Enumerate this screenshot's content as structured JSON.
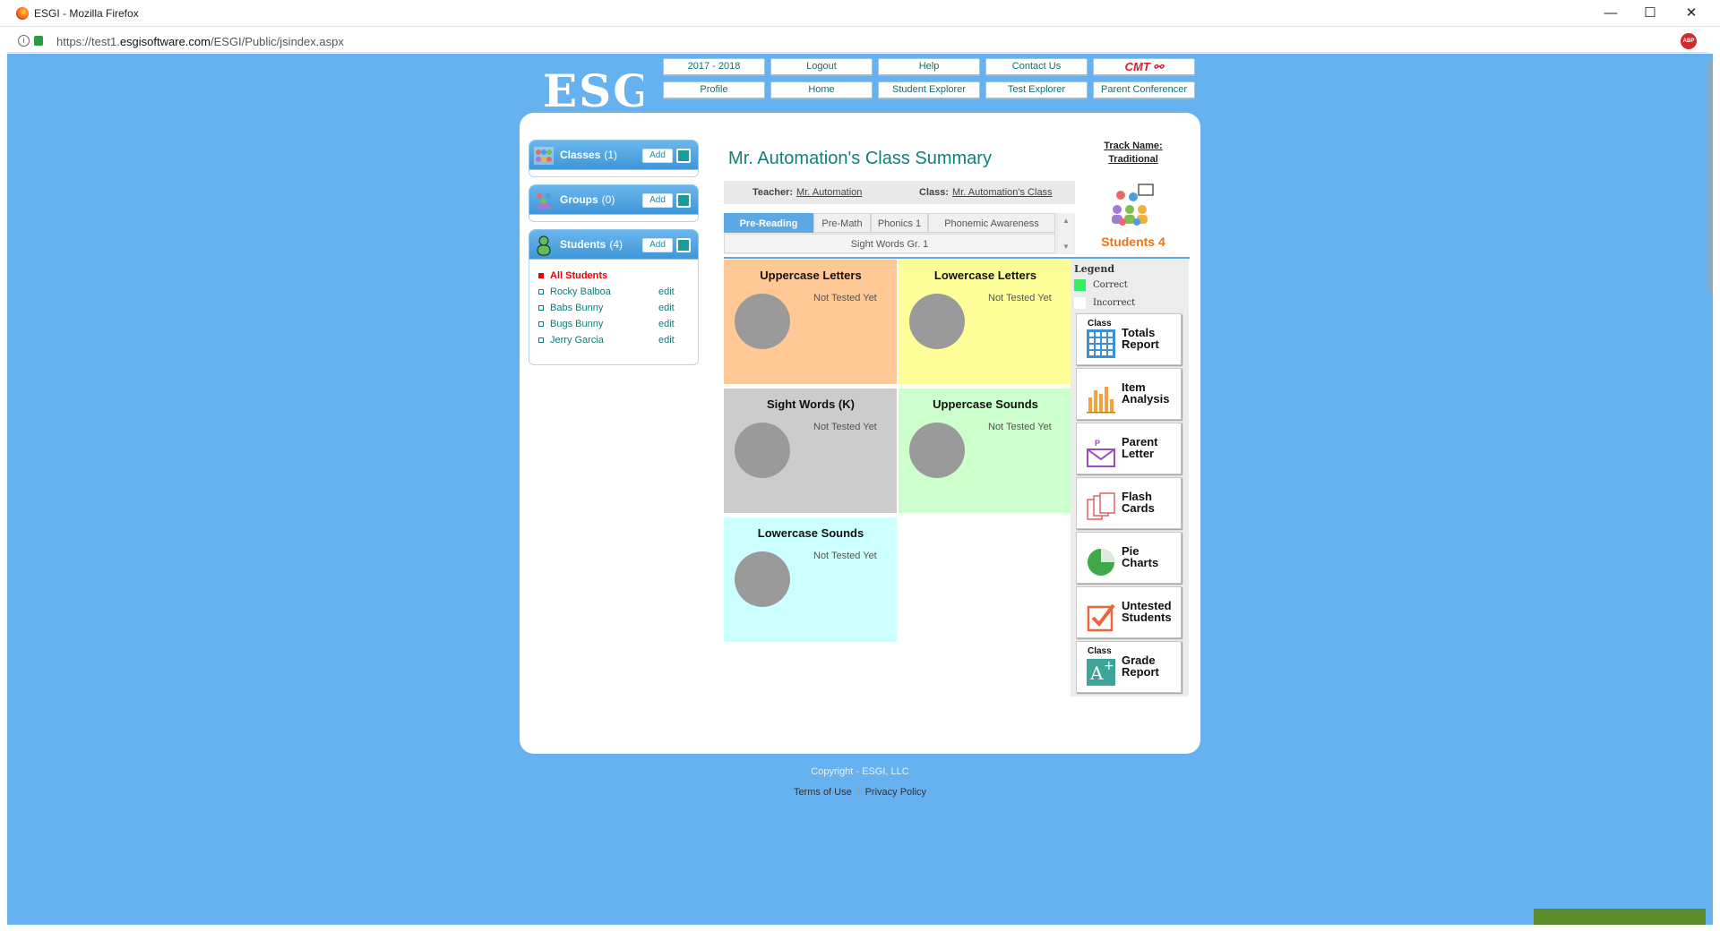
{
  "browser": {
    "title": "ESGI - Mozilla Firefox",
    "url_host": "https://test1.",
    "url_domain": "esgisoftware.com",
    "url_path": "/ESGI/Public/jsindex.aspx",
    "abp": "ABP",
    "controls": {
      "minimize": "—",
      "maximize": "☐",
      "close": "✕"
    }
  },
  "logo": "ESGI",
  "nav": {
    "row1": [
      "2017 - 2018",
      "Logout",
      "Help",
      "Contact Us"
    ],
    "cmt": "CMT ⚯",
    "row2": [
      "Profile",
      "Home",
      "Student Explorer",
      "Test Explorer",
      "Parent Conferencer"
    ]
  },
  "sidebar": {
    "classes": {
      "label": "Classes",
      "count": "(1)",
      "add": "Add"
    },
    "groups": {
      "label": "Groups",
      "count": "(0)",
      "add": "Add"
    },
    "students": {
      "label": "Students",
      "count": "(4)",
      "add": "Add"
    },
    "all_students": "All Students",
    "student_list": [
      {
        "name": "Rocky Balboa",
        "edit": "edit"
      },
      {
        "name": "Babs Bunny",
        "edit": "edit"
      },
      {
        "name": "Bugs Bunny",
        "edit": "edit"
      },
      {
        "name": "Jerry Garcia",
        "edit": "edit"
      }
    ]
  },
  "summary": {
    "title": "Mr. Automation's Class Summary",
    "teacher_label": "Teacher:",
    "teacher": "Mr. Automation",
    "class_label": "Class:",
    "class": "Mr. Automation's Class",
    "track_label": "Track Name:",
    "track": "Traditional",
    "students_total": "Students 4"
  },
  "tabs": {
    "row1": [
      "Pre-Reading",
      "Pre-Math",
      "Phonics 1",
      "Phonemic Awareness"
    ],
    "row2": "Sight Words Gr. 1",
    "active": "Pre-Reading",
    "scroll_up": "▲",
    "scroll_down": "▼"
  },
  "tiles": [
    {
      "title": "Uppercase Letters",
      "status": "Not Tested Yet",
      "color": "#ffc894"
    },
    {
      "title": "Lowercase Letters",
      "status": "Not Tested Yet",
      "color": "#ffff99"
    },
    {
      "title": "Sight Words (K)",
      "status": "Not Tested Yet",
      "color": "#cccccc"
    },
    {
      "title": "Uppercase Sounds",
      "status": "Not Tested Yet",
      "color": "#ccffcc"
    },
    {
      "title": "Lowercase Sounds",
      "status": "Not Tested Yet",
      "color": "#ccffff"
    }
  ],
  "legend": {
    "title": "Legend",
    "correct": "Correct",
    "incorrect": "Incorrect",
    "correct_color": "#33ee66",
    "incorrect_color": "#ffffff"
  },
  "reports": [
    {
      "small": "Class",
      "line1": "Totals",
      "line2": "Report",
      "icon": "grid-icon"
    },
    {
      "small": "",
      "line1": "Item",
      "line2": "Analysis",
      "icon": "bar-chart-icon"
    },
    {
      "small": "",
      "line1": "Parent",
      "line2": "Letter",
      "icon": "envelope-icon"
    },
    {
      "small": "",
      "line1": "Flash",
      "line2": "Cards",
      "icon": "cards-icon"
    },
    {
      "small": "",
      "line1": "Pie",
      "line2": "Charts",
      "icon": "pie-chart-icon"
    },
    {
      "small": "",
      "line1": "Untested",
      "line2": "Students",
      "icon": "checkbox-icon"
    },
    {
      "small": "Class",
      "line1": "Grade",
      "line2": "Report",
      "icon": "grade-icon"
    }
  ],
  "footer": {
    "terms": "Terms of Use",
    "sep": "|",
    "privacy": "Privacy Policy",
    "copyright": "Copyright - ESGI, LLC"
  },
  "colors": {
    "page_bg": "#66b1ef",
    "accent": "#11807a",
    "active_tab": "#5ca8e4",
    "students_orange": "#e8771c"
  }
}
